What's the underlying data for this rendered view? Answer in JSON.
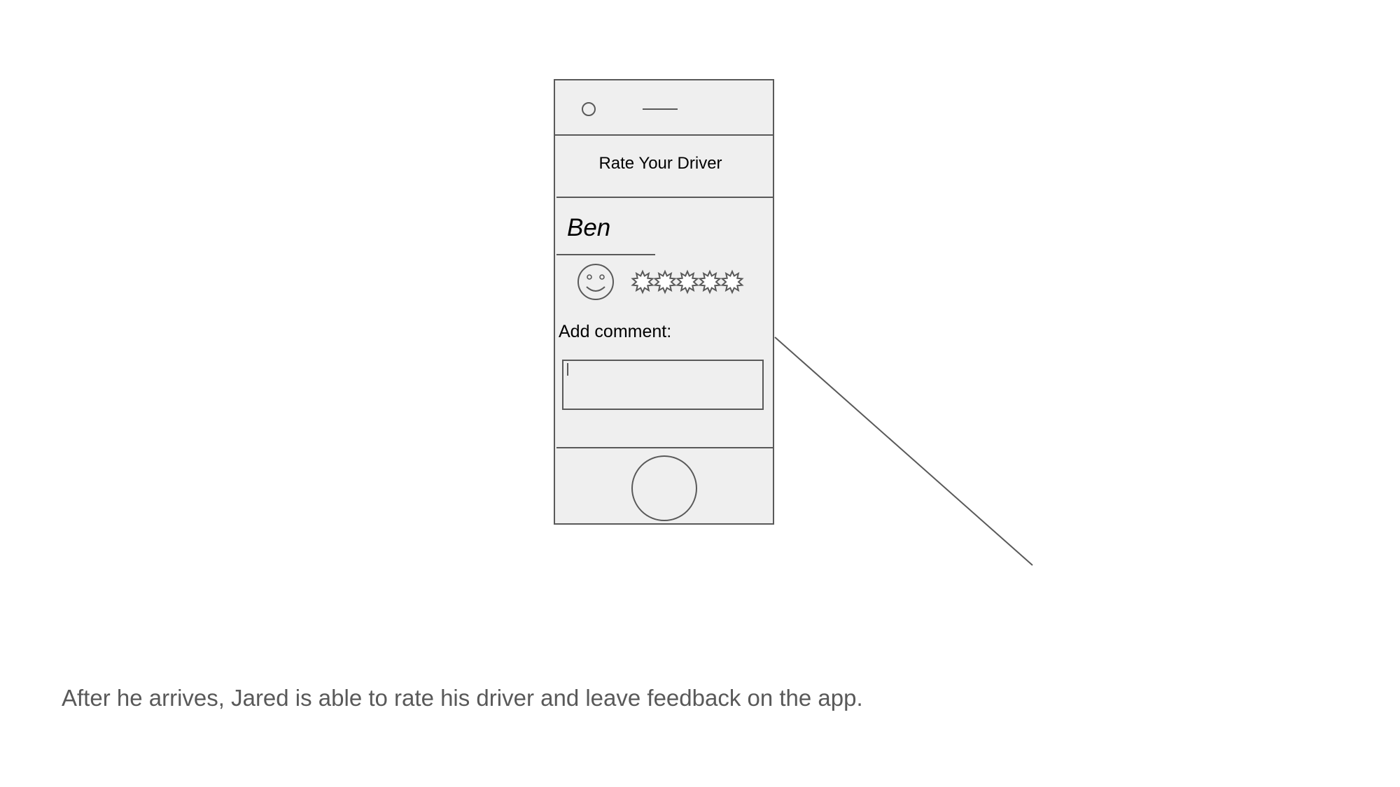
{
  "phone": {
    "screen_title": "Rate Your Driver",
    "driver_name": "Ben",
    "rating": {
      "max_stars": 5,
      "stars_filled": 0,
      "face_icon": "smiley-face-icon",
      "star_icon": "star-burst-icon"
    },
    "comment_label": "Add comment:",
    "comment_value": "",
    "icons": {
      "camera": "front-camera-icon",
      "speaker": "speaker-icon",
      "home": "home-button-icon"
    }
  },
  "caption": "After he arrives, Jared is able to rate his driver and leave feedback on the app.",
  "colors": {
    "outline": "#595959",
    "phone_fill": "#efefef",
    "caption_text": "#595959"
  }
}
